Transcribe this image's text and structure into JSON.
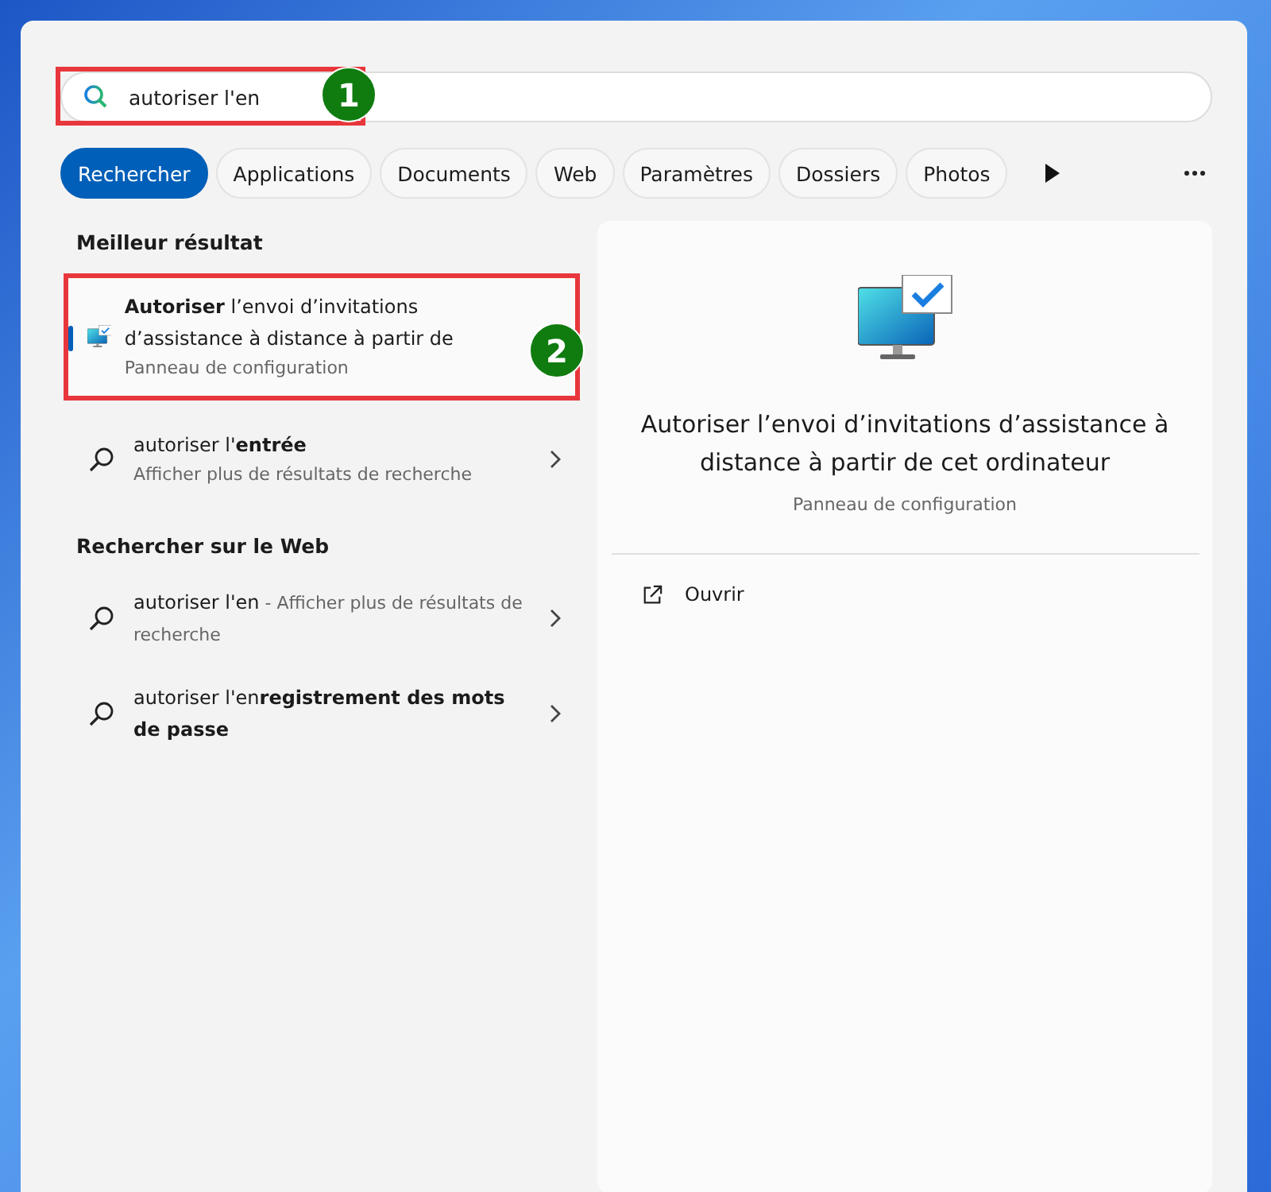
{
  "search": {
    "value": "autoriser l'en",
    "callout": "1"
  },
  "filters": [
    {
      "label": "Rechercher",
      "selected": true
    },
    {
      "label": "Applications",
      "selected": false
    },
    {
      "label": "Documents",
      "selected": false
    },
    {
      "label": "Web",
      "selected": false
    },
    {
      "label": "Paramètres",
      "selected": false
    },
    {
      "label": "Dossiers",
      "selected": false
    },
    {
      "label": "Photos",
      "selected": false
    }
  ],
  "best_match": {
    "heading": "Meilleur résultat",
    "title": "**Autoriser** l’envoi d’invitations d’assistance à distance à partir de",
    "subtitle": "Panneau de configuration",
    "selected": true,
    "callout": "2"
  },
  "suggestions": [
    {
      "title": "autoriser l'**entrée**",
      "subtitle": "Afficher plus de résultats de recherche"
    }
  ],
  "web": {
    "heading": "Rechercher sur le Web",
    "results": [
      {
        "title": "autoriser l'en",
        "description": "- Afficher plus de résultats de recherche"
      },
      {
        "title": "autoriser l'en**registrement des mots de passe**"
      }
    ]
  },
  "details": {
    "title": "Autoriser l’envoi d’invitations d’assistance à distance à partir de cet ordinateur",
    "subtitle": "Panneau de configuration",
    "actions": [
      {
        "label": "Ouvrir"
      }
    ]
  }
}
